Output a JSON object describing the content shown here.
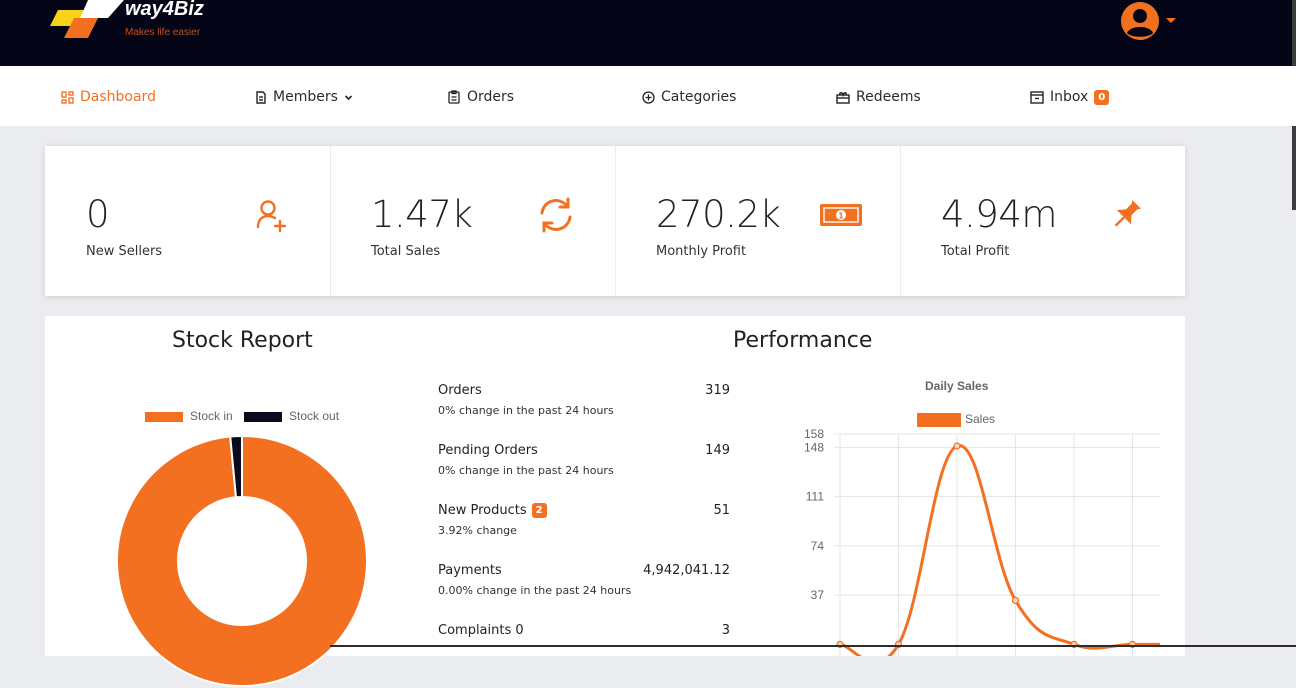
{
  "brand": {
    "name": "way4Biz",
    "tagline": "Makes life easier",
    "accent": "#f47021",
    "header_bg": "#040617"
  },
  "nav": {
    "items": [
      {
        "label": "Dashboard",
        "icon": "dashboard-icon",
        "active": true
      },
      {
        "label": "Members",
        "icon": "document-icon",
        "dropdown": true
      },
      {
        "label": "Orders",
        "icon": "clipboard-icon"
      },
      {
        "label": "Categories",
        "icon": "circle-plus-icon"
      },
      {
        "label": "Redeems",
        "icon": "gift-icon"
      },
      {
        "label": "Inbox",
        "icon": "inbox-icon",
        "badge": "0"
      }
    ]
  },
  "stats": [
    {
      "value": "0",
      "label": "New Sellers",
      "icon": "add-user-icon"
    },
    {
      "value": "1.47k",
      "label": "Total Sales",
      "icon": "sync-icon"
    },
    {
      "value": "270.2k",
      "label": "Monthly Profit",
      "icon": "money-bill-icon"
    },
    {
      "value": "4.94m",
      "label": "Total Profit",
      "icon": "pin-icon"
    }
  ],
  "stock": {
    "title": "Stock Report",
    "legend": [
      "Stock in",
      "Stock out"
    ],
    "chart_data": {
      "type": "pie",
      "categories": [
        "Stock in",
        "Stock out"
      ],
      "values": [
        98.5,
        1.5
      ],
      "colors": [
        "#f47021",
        "#0a0a1e"
      ],
      "legend_position": "top"
    }
  },
  "performance": {
    "title": "Performance",
    "rows": [
      {
        "name": "Orders",
        "value": "319",
        "sub": "0% change in the past 24 hours"
      },
      {
        "name": "Pending Orders",
        "value": "149",
        "sub": "0% change in the past 24 hours"
      },
      {
        "name": "New Products",
        "badge": "2",
        "value": "51",
        "sub": "3.92% change"
      },
      {
        "name": "Payments",
        "value": "4,942,041.12",
        "sub": "0.00% change in the past 24 hours"
      },
      {
        "name": "Complaints 0",
        "value": "3",
        "sub": ""
      }
    ]
  },
  "daily_sales": {
    "title": "Daily Sales",
    "legend": "Sales",
    "chart_data": {
      "type": "line",
      "title": "Daily Sales",
      "series": [
        {
          "name": "Sales",
          "values": [
            0,
            0,
            149,
            33,
            0,
            0,
            0
          ]
        }
      ],
      "y_ticks": [
        "37",
        "74",
        "111",
        "148",
        "158"
      ],
      "ylim": [
        0,
        158
      ],
      "color": "#f47021",
      "grid": true,
      "legend_position": "top"
    }
  }
}
